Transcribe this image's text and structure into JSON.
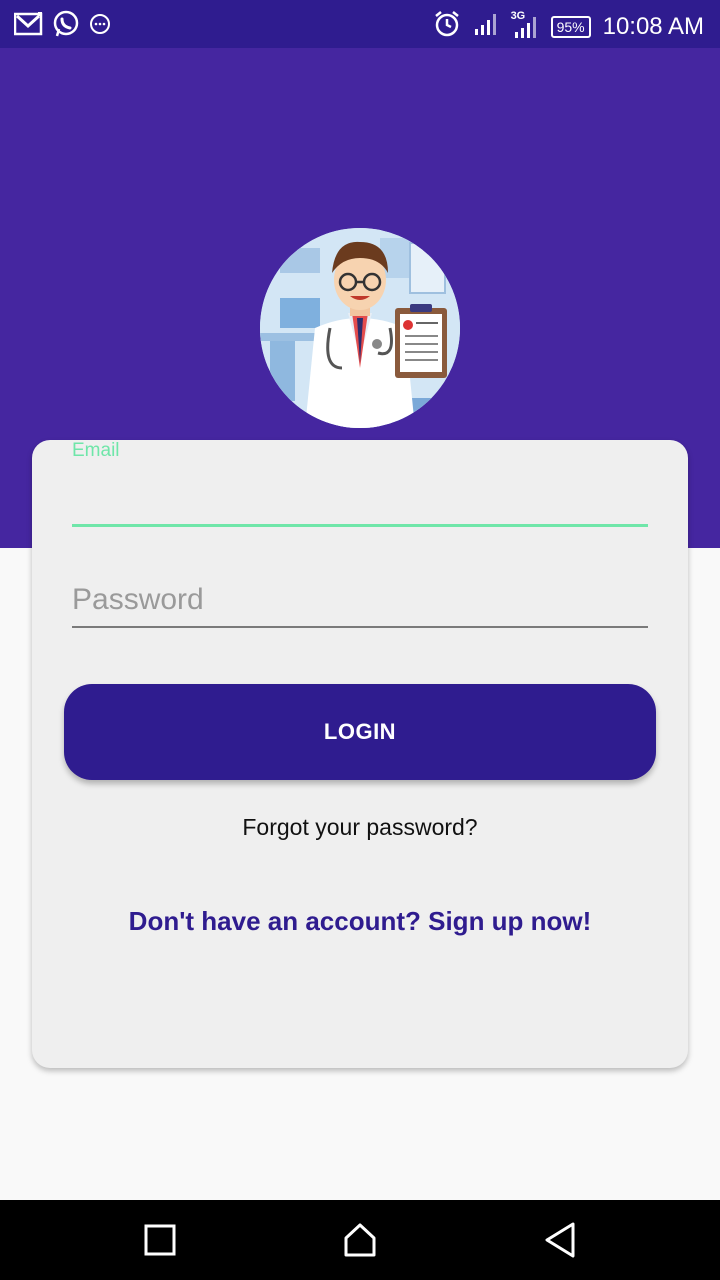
{
  "status_bar": {
    "left_icons": [
      "gmail-icon",
      "whatsapp-icon",
      "chat-bubble-icon"
    ],
    "right_icons": [
      "alarm-icon",
      "signal-icon",
      "3g-signal-icon"
    ],
    "network_label": "3G",
    "battery": "95%",
    "time": "10:08 AM"
  },
  "header": {
    "avatar": "doctor-avatar-icon"
  },
  "login_form": {
    "email_label": "Email",
    "email_value": "",
    "password_placeholder": "Password",
    "password_value": "",
    "login_label": "LOGIN",
    "forgot_label": "Forgot your password?",
    "signup_label": "Don't have an account? Sign up now!"
  },
  "nav_bar": {
    "buttons": [
      "recents-icon",
      "home-icon",
      "back-icon"
    ]
  },
  "colors": {
    "status_bar": "#2f1c8f",
    "header": "#4526a0",
    "accent": "#6fe6a9",
    "button": "#2f1c8f",
    "card": "#efefef"
  }
}
